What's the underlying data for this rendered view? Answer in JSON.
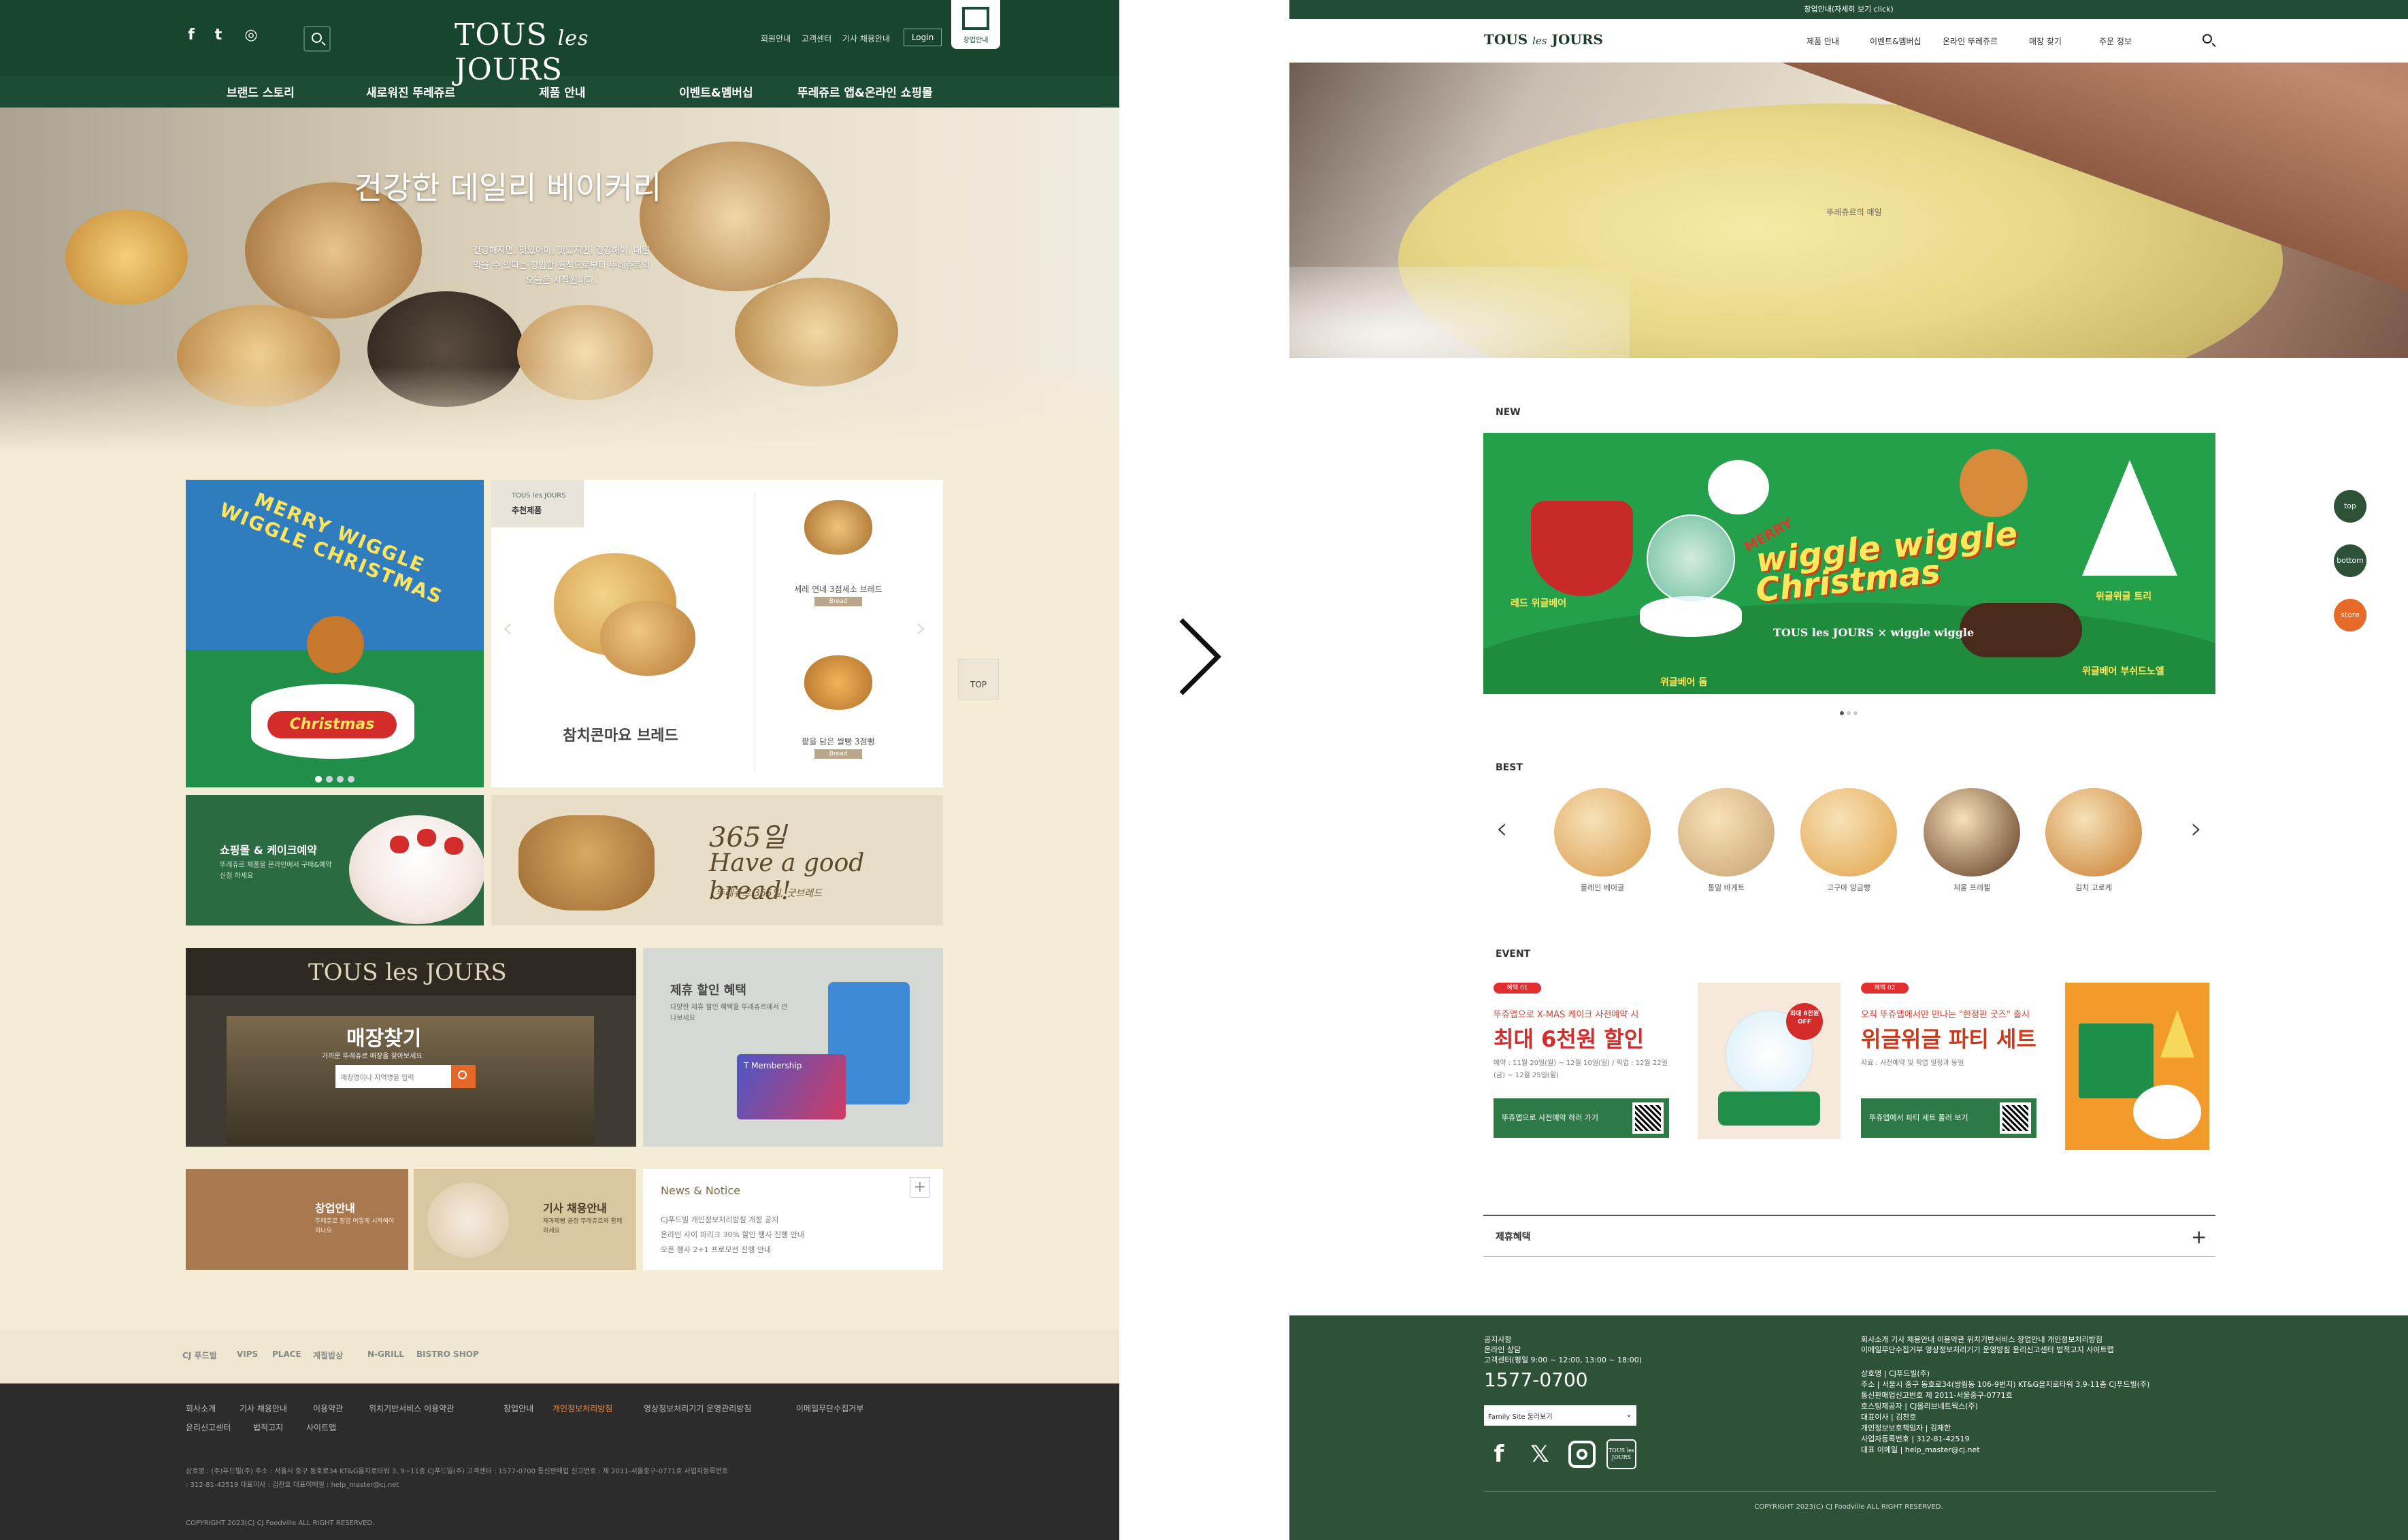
{
  "old": {
    "social": [
      "f",
      "t",
      "◎"
    ],
    "logo": {
      "main1": "TOUS ",
      "les": "les",
      "main2": " JOURS"
    },
    "util": [
      "회원안내",
      "고객센터",
      "기사 채용안내"
    ],
    "login": "Login",
    "franchise": "창업안내",
    "gnb": [
      "브랜드 스토리",
      "새로워진 뚜레쥬르",
      "제품 안내",
      "이벤트&멤버십",
      "뚜레쥬르 앱&온라인 쇼핑몰"
    ],
    "hero": {
      "title": "건강한 데일리 베이커리",
      "copy": "건강해지면, 맛있어야, 맛있지면, 건강해야, 매일 먹을 수 있다는 평범한 원칙으로부터 뚜레쥬르의 오늘은 시작됩니다."
    },
    "xmas": {
      "title": "MERRY WIGGLE WIGGLE CHRISTMAS",
      "cake_text": "Christmas"
    },
    "reco": {
      "tag_brand": "TOUS les JOURS",
      "tag_label": "추천제품",
      "main_name": "참치콘마요 브레드",
      "items": [
        {
          "name": "세레 연네 3점세소 브레드",
          "badge": "Bread"
        },
        {
          "name": "팥을 담은 쌀빵 3점빵",
          "badge": "Bread"
        }
      ]
    },
    "top_btn": "TOP",
    "shop": {
      "title": "쇼핑몰 & 케이크예약",
      "copy": "뚜레쥬르 제품을 온라인에서 구매&예약신청 하세요"
    },
    "banner365": {
      "head": "365일",
      "sub": "Have a good bread!",
      "copy": "뚜레쥬르 365일, 굿브레드"
    },
    "store": {
      "sign": "TOUS les JOURS",
      "find": "매장찾기",
      "sub": "가까운 뚜레쥬르 매장을 찾아보세요",
      "placeholder": "매장명이나 지역명을 입력"
    },
    "member": {
      "title": "제휴 할인 혜택",
      "copy": "다양한 제휴 할인 혜택을 뚜레쥬르에서 만나보세요",
      "card": "T Membership"
    },
    "job1": {
      "title": "창업안내",
      "sub": "뚜레쥬르 창업 어떻게 시작해야 하나요"
    },
    "job2": {
      "title": "기사 채용안내",
      "sub": "제과제빵 공정 뚜레쥬르와 함께 하세요"
    },
    "news": {
      "title": "News & Notice",
      "items": [
        "CJ푸드빌 개인정보처리방침 개정 공지",
        "온라인 사이 파리크 30% 할인 행사 진행 안내",
        "오픈 행사 2+1 프로모션 진행 안내"
      ]
    },
    "family": [
      "CJ 푸드빌",
      "VIPS",
      "PLACE",
      "계절밥상",
      "N-GRILL",
      "BISTRO SHOP"
    ],
    "footer": {
      "links": [
        "회사소개",
        "기사 채용안내",
        "이용약관",
        "위치기반서비스 이용약관",
        "창업안내",
        "개인정보처리방침",
        "영상정보처리기기 운영관리방침",
        "이메일무단수집거부",
        "윤리신고센터",
        "법적고지",
        "사이트맵"
      ],
      "info": "상호명 : (주)푸드빌(주) 주소 : 서울시 중구 동호로34 KT&G을지로타워 3, 9~11층 CJ푸드빌(주) 고객센터 : 1577-0700 통신판매업 신고번호 : 제 2011-서울중구-0771호 사업자등록번호 : 312-81-42519 대표이사 : 김찬호 대표이메일 : help_master@cj.net",
      "copy": "COPYRIGHT 2023(C) CJ Foodville ALL RIGHT RESERVED."
    }
  },
  "new": {
    "topbar": "창업안내(자세히 보기 click)",
    "logo": {
      "main1": "TOUS ",
      "les": "les",
      "main2": " JOURS"
    },
    "gnb": [
      "제품 안내",
      "이벤트&멤버십",
      "온라인 뚜레쥬르",
      "매장 찾기",
      "주문 정보"
    ],
    "hero_caption": "뚜레쥬르의 매일",
    "sections": {
      "new": "NEW",
      "best": "BEST",
      "event": "EVENT"
    },
    "banner": {
      "merry": "MERRY",
      "title1": "wiggle wiggle",
      "title2": "Christmas",
      "brand": "TOUS les JOURS × wiggle wiggle",
      "labels": [
        "레드 위글베어",
        "위글베어 돔",
        "위글위글 트리",
        "위글베어 부쉬드노엘"
      ]
    },
    "best": [
      {
        "name": "플레인 베이글",
        "color": "#d89a4a"
      },
      {
        "name": "통밀 바게트",
        "color": "#c8a070"
      },
      {
        "name": "고구마 앙금빵",
        "color": "#e2a247"
      },
      {
        "name": "저울 프레첼",
        "color": "#5c3520"
      },
      {
        "name": "김치 고로케",
        "color": "#c77a2b"
      }
    ],
    "events": [
      {
        "tag": "혜택 01",
        "sub": "뚜쥬앱으로 X-MAS 케이크 사전예약 시",
        "head": "최대 6천원 할인",
        "detail": "예약 : 11월 20일(월) ~ 12월 10일(일) / 픽업 : 12월 22일(금) ~ 12월 25일(월)",
        "cta": "뚜쥬앱으로 사전예약 하러 가기"
      },
      {
        "tag": "혜택 02",
        "sub": "오직 뚜쥬앱에서만 만나는 \"한정판 굿즈\" 출시",
        "head": "위글위글 파티 세트",
        "detail": "자료 : 사전예약 및 픽업 일정과 동일",
        "cta": "뚜쥬앱에서 파티 세트 풀러 보기"
      }
    ],
    "event_badge": "최대 6천원 OFF",
    "partner": "제휴혜택",
    "side": [
      "top",
      "bottom",
      "store"
    ],
    "footer": {
      "col1": [
        "공지사항",
        "온라인 상담",
        "고객센터(평일 9:00 ~ 12:00, 13:00 ~ 18:00)"
      ],
      "phone": "1577-0700",
      "family": "Family Site 둘러보기",
      "col2": [
        "회사소개   기사 채용안내   이용약관   위치기반서비스   창업안내   개인정보처리방침",
        "이메일무단수집거부   영상정보처리기기 운영방침   윤리신고센터   법적고지   사이트맵"
      ],
      "col3": [
        "상호명 | CJ푸드빌(주)",
        "주소 | 서울시 중구 동호로34(쌍림동 106-9번지) KT&G을지로타워 3,9-11층 CJ푸드빌(주)",
        "통신판매업신고번호 제 2011-서울중구-0771호",
        "호스팅제공자 | CJ올리브네트웍스(주)",
        "대표이사 | 김찬호",
        "개인정보보호책임자 | 김재한",
        "사업자등록번호 | 312-81-42519",
        "대표 이메일 | help_master@cj.net"
      ],
      "logo": "TOUS les JOURS",
      "copy": "COPYRIGHT 2023(C) CJ Foodville ALL RIGHT RESERVED."
    }
  },
  "colors": {
    "old_green": "#1c4d34",
    "new_green": "#224d34",
    "cream": "#f5ecd6",
    "accent_red": "#d42b2b",
    "side_orange": "#e76a29"
  }
}
